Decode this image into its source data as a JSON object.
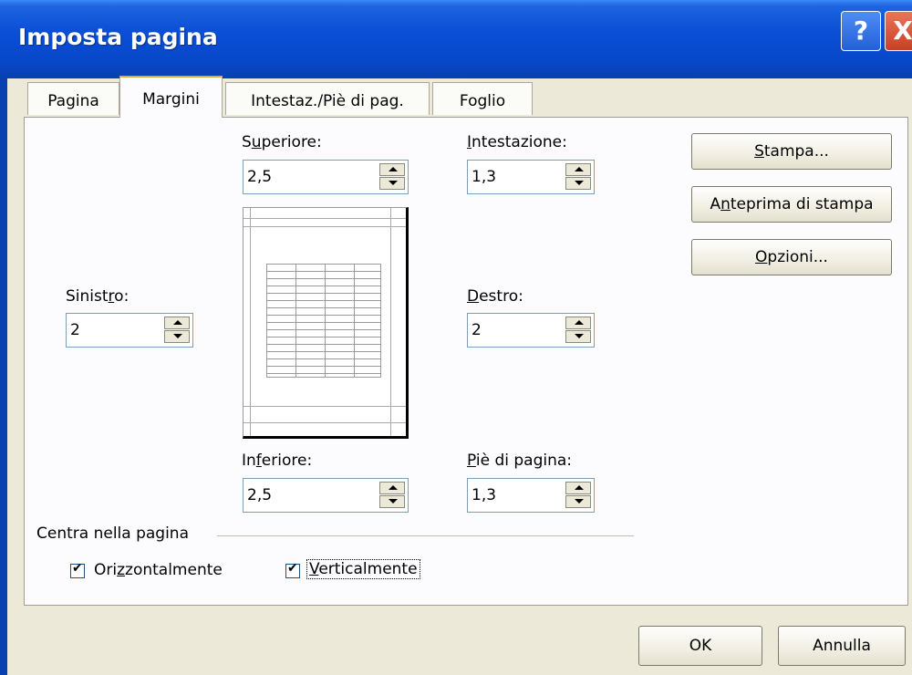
{
  "window": {
    "title": "Imposta pagina",
    "help_glyph": "?",
    "close_glyph": "X"
  },
  "tabs": [
    {
      "label": "Pagina",
      "active": false
    },
    {
      "label": "Margini",
      "active": true
    },
    {
      "label": "Intestaz./Piè di pag.",
      "active": false
    },
    {
      "label": "Foglio",
      "active": false
    }
  ],
  "margins": {
    "superiore": {
      "label_pre": "S",
      "label_u": "u",
      "label_post": "periore:",
      "value": "2,5"
    },
    "intestazione": {
      "label_pre": "",
      "label_u": "I",
      "label_post": "ntestazione:",
      "value": "1,3"
    },
    "sinistro": {
      "label_pre": "Sinist",
      "label_u": "r",
      "label_post": "o:",
      "value": "2"
    },
    "destro": {
      "label_pre": "",
      "label_u": "D",
      "label_post": "estro:",
      "value": "2"
    },
    "inferiore": {
      "label_pre": "In",
      "label_u": "f",
      "label_post": "eriore:",
      "value": "2,5"
    },
    "pie_di_pagina": {
      "label_pre": "",
      "label_u": "P",
      "label_post": "iè di pagina:",
      "value": "1,3"
    }
  },
  "center": {
    "group_label": "Centra nella pagina",
    "orizzontalmente": {
      "pre": "Ori",
      "u": "z",
      "post": "zontalmente",
      "checked": true
    },
    "verticalmente": {
      "pre": "",
      "u": "V",
      "post": "erticalmente",
      "checked": true
    }
  },
  "side_buttons": {
    "stampa": {
      "pre": "",
      "u": "S",
      "post": "tampa..."
    },
    "anteprima": {
      "pre": "A",
      "u": "n",
      "post": "teprima di stampa"
    },
    "opzioni": {
      "pre": "",
      "u": "O",
      "post": "pzioni..."
    }
  },
  "footer": {
    "ok": "OK",
    "annulla": "Annulla"
  },
  "colors": {
    "titlebar": "#0a4fd6",
    "face": "#ece9d8",
    "tab_highlight": "#e6a83b"
  }
}
